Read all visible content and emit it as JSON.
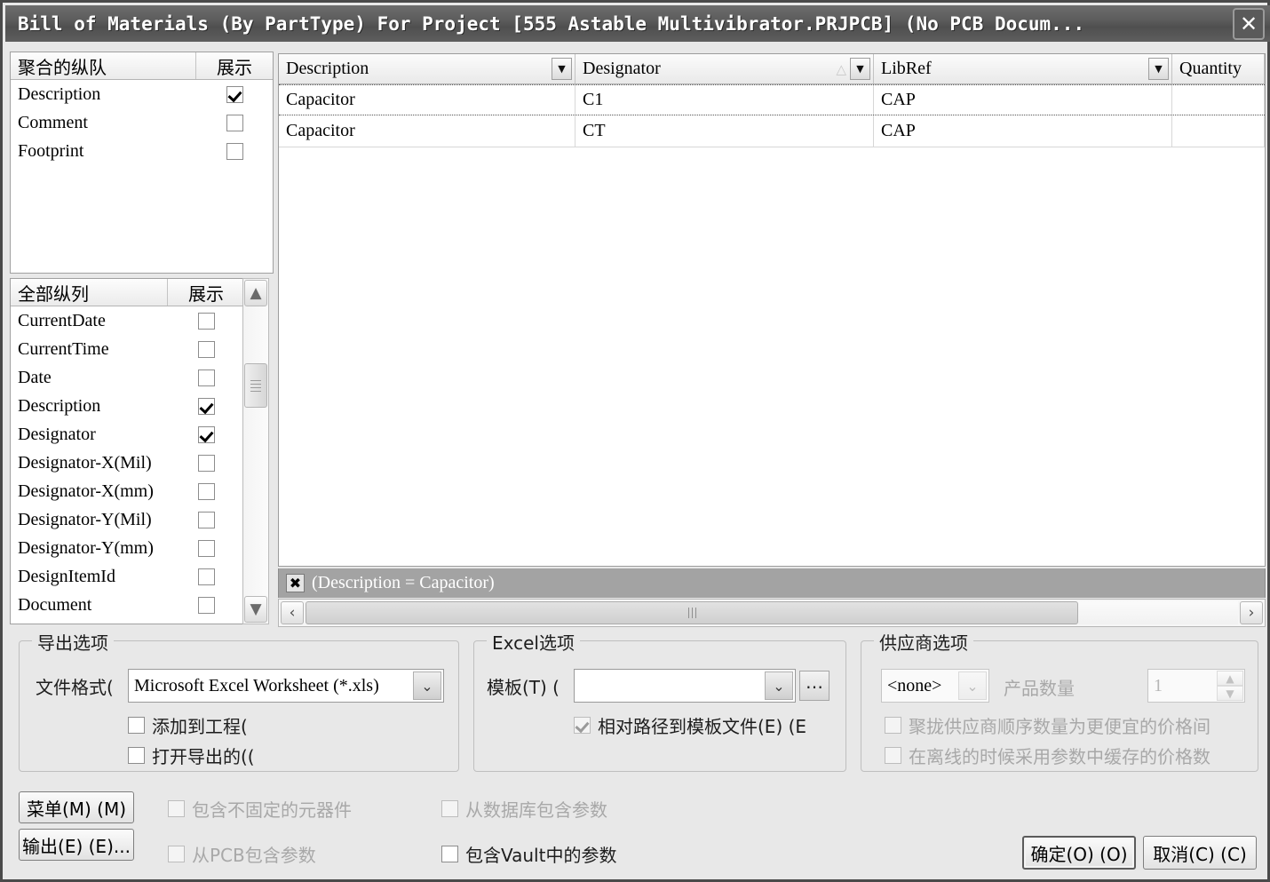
{
  "window": {
    "title": "Bill of Materials (By PartType) For Project [555 Astable Multivibrator.PRJPCB] (No PCB Docum...",
    "close_icon": "close-icon",
    "close_glyph": "✕"
  },
  "grouped_columns": {
    "header_name": "聚合的纵队",
    "header_show": "展示",
    "items": [
      {
        "label": "Description",
        "checked": true
      },
      {
        "label": "Comment",
        "checked": false
      },
      {
        "label": "Footprint",
        "checked": false
      }
    ]
  },
  "all_columns": {
    "header_name": "全部纵列",
    "header_show": "展示",
    "scroll_up_glyph": "▲",
    "scroll_down_glyph": "▼",
    "items": [
      {
        "label": "CurrentDate",
        "checked": false
      },
      {
        "label": "CurrentTime",
        "checked": false
      },
      {
        "label": "Date",
        "checked": false
      },
      {
        "label": "Description",
        "checked": true
      },
      {
        "label": "Designator",
        "checked": true
      },
      {
        "label": "Designator-X(Mil)",
        "checked": false
      },
      {
        "label": "Designator-X(mm)",
        "checked": false
      },
      {
        "label": "Designator-Y(Mil)",
        "checked": false
      },
      {
        "label": "Designator-Y(mm)",
        "checked": false
      },
      {
        "label": "DesignItemId",
        "checked": false
      },
      {
        "label": "Document",
        "checked": false
      }
    ]
  },
  "table": {
    "columns": [
      {
        "label": "Description",
        "has_filter": true,
        "sorted": ""
      },
      {
        "label": "Designator",
        "has_filter": true,
        "sorted": "asc"
      },
      {
        "label": "LibRef",
        "has_filter": true,
        "sorted": ""
      },
      {
        "label": "Quantity",
        "has_filter": false,
        "sorted": ""
      }
    ],
    "sort_asc_glyph": "△",
    "filter_glyph": "▼",
    "rows": [
      {
        "Description": "Capacitor",
        "Designator": "C1",
        "LibRef": "CAP",
        "Quantity": ""
      },
      {
        "Description": "Capacitor",
        "Designator": "CT",
        "LibRef": "CAP",
        "Quantity": ""
      }
    ]
  },
  "filter_bar": {
    "close_glyph": "✖",
    "expression": "(Description = Capacitor)"
  },
  "hscroll": {
    "left_glyph": "‹",
    "right_glyph": "›"
  },
  "export_options": {
    "title": "导出选项",
    "file_format_label": "文件格式(",
    "file_format_value": "Microsoft Excel Worksheet (*.xls)",
    "dropdown_glyph": "⌄",
    "checkboxes": [
      {
        "label": "添加到工程(",
        "checked": false,
        "enabled": true
      },
      {
        "label": "打开导出的((",
        "checked": false,
        "enabled": true
      }
    ]
  },
  "excel_options": {
    "title": "Excel选项",
    "template_label": "模板(T) (",
    "template_value": "",
    "dropdown_glyph": "⌄",
    "browse_label": "…",
    "checkbox": {
      "label": "相对路径到模板文件(E) (E",
      "checked": true,
      "enabled": false
    }
  },
  "supplier_options": {
    "title": "供应商选项",
    "supplier_value": "<none>",
    "dropdown_glyph": "⌄",
    "quantity_label": "产品数量",
    "quantity_value": "1",
    "spin_up_glyph": "▲",
    "spin_down_glyph": "▼",
    "checkboxes": [
      {
        "label": "聚拢供应商顺序数量为更便宜的价格间",
        "checked": false,
        "enabled": false
      },
      {
        "label": "在离线的时候采用参数中缓存的价格数",
        "checked": false,
        "enabled": false
      }
    ]
  },
  "footer": {
    "menu_button": "菜单(M) (M)",
    "export_button": "输出(E) (E)...",
    "checkboxes": [
      {
        "label": "包含不固定的元器件",
        "checked": false,
        "enabled": false
      },
      {
        "label": "从PCB包含参数",
        "checked": false,
        "enabled": false
      },
      {
        "label": "从数据库包含参数",
        "checked": false,
        "enabled": false
      },
      {
        "label": "包含Vault中的参数",
        "checked": false,
        "enabled": true
      }
    ],
    "ok_button": "确定(O) (O)",
    "cancel_button": "取消(C) (C)"
  }
}
